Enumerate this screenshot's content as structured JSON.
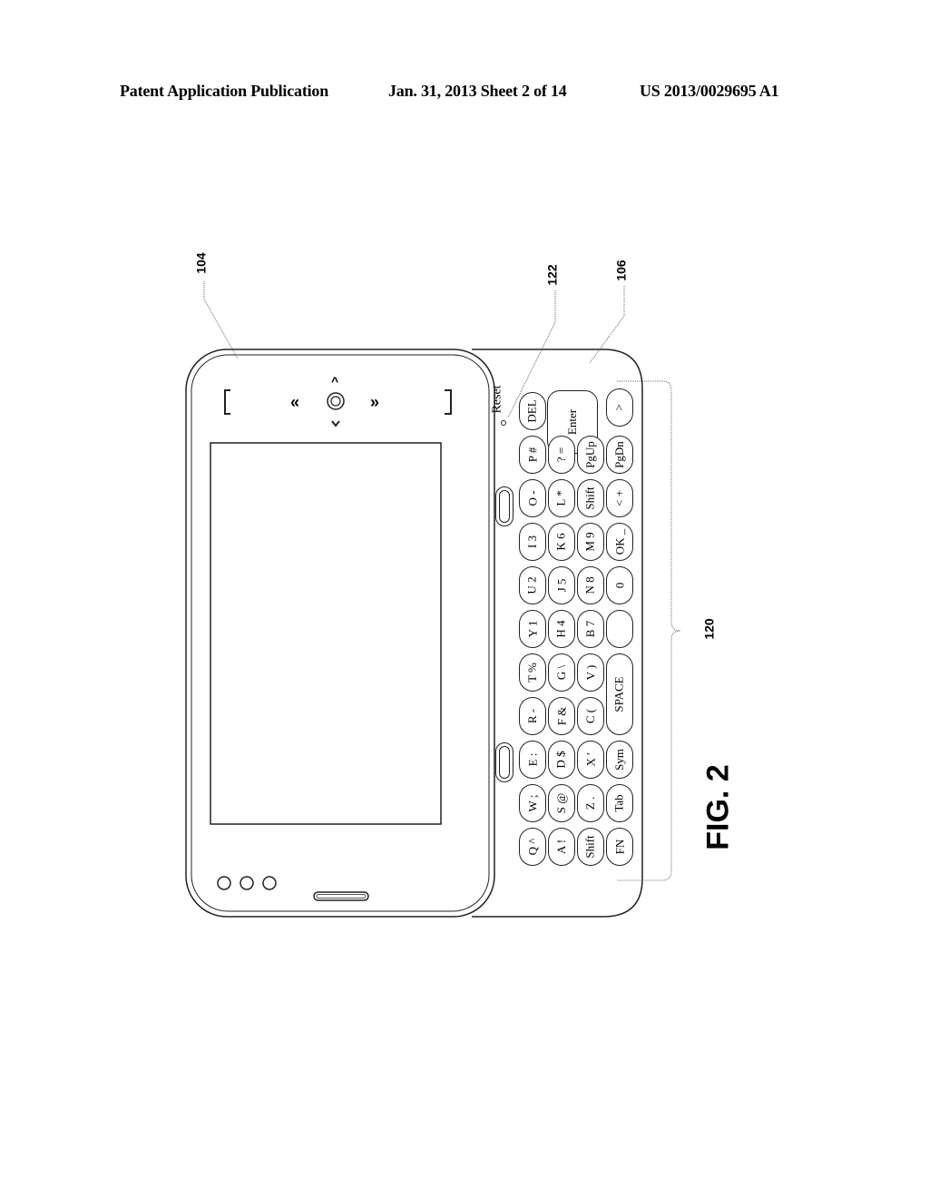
{
  "header": {
    "left": "Patent Application Publication",
    "center": "Jan. 31, 2013  Sheet 2 of 14",
    "right": "US 2013/0029695 A1"
  },
  "figure": {
    "label": "FIG. 2",
    "reference_numerals": {
      "slide_top": "104",
      "reset": "122",
      "slide_bottom": "106",
      "keyboard": "120"
    },
    "reset_label": "Reset",
    "keyboard_rows": [
      [
        "DEL",
        "P #",
        "O -",
        "I 3",
        "U 2",
        "Y 1",
        "T %",
        "R -",
        "E :",
        "W ;",
        "Q ^"
      ],
      [
        "? =",
        "L *",
        "K 6",
        "J 5",
        "H 4",
        "G \\",
        "F &",
        "D $",
        "S @",
        "A !"
      ],
      [
        "PgUp",
        "Shift",
        "M 9",
        "N 8",
        "B 7",
        "V )",
        "C (",
        "X '",
        "Z .",
        "Shift"
      ],
      [
        ">",
        "PgDn",
        "< +",
        "OK _",
        "0",
        "",
        "SPACE",
        "Sym",
        "Tab",
        "FN"
      ]
    ],
    "enter_label": "Enter"
  }
}
